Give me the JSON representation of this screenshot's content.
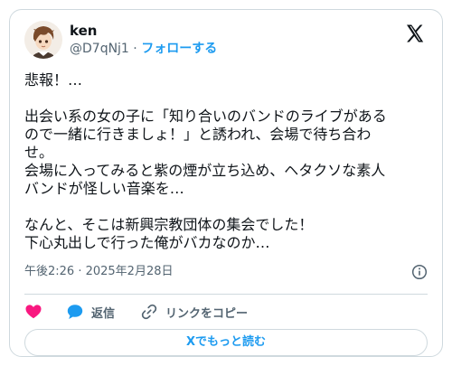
{
  "user": {
    "display_name": "ken",
    "handle": "@D7qNj1",
    "separator": "·",
    "follow_label": "フォローする"
  },
  "tweet": {
    "text": "悲報！…\n\n出会い系の女の子に「知り合いのバンドのライブがある\nので一緒に行きましょ！」と誘われ、会場で待ち合わ\nせ。\n会場に入ってみると紫の煙が立ち込め、ヘタクソな素人\nバンドが怪しい音楽を…\n\nなんと、そこは新興宗教団体の集会でした！\n下心丸出しで行った俺がバカなのか…",
    "timestamp": "午後2:26 · 2025年2月28日"
  },
  "actions": {
    "like_label": "",
    "reply_label": "返信",
    "copy_link_label": "リンクをコピー"
  },
  "read_more_label": "Xでもっと読む",
  "icons": {
    "logo": "x-logo-icon",
    "info": "info-icon",
    "like": "heart-icon",
    "reply": "speech-bubble-icon",
    "link": "link-icon"
  },
  "colors": {
    "accent": "#1d9bf0",
    "like": "#f91880",
    "text": "#0f1419",
    "secondary": "#536471",
    "border": "#cfd9de"
  }
}
